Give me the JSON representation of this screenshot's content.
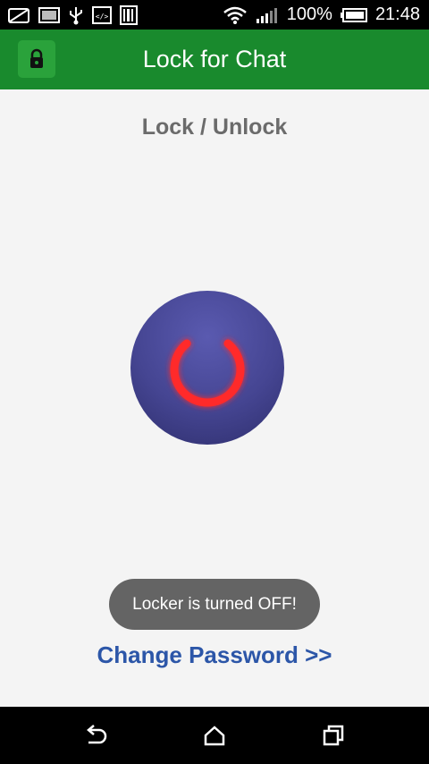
{
  "status_bar": {
    "battery_text": "100%",
    "time": "21:48",
    "icons": [
      "no-sim-icon",
      "screenshot-icon",
      "usb-icon",
      "developer-icon",
      "barcode-icon",
      "wifi-icon",
      "signal-icon",
      "battery-icon"
    ]
  },
  "app_bar": {
    "title": "Lock for Chat",
    "icon": "lock-icon"
  },
  "main": {
    "section_title": "Lock / Unlock",
    "power_button_icon": "power-icon",
    "toast_text": "Locker is turned OFF!",
    "change_password_label": "Change Password >>"
  },
  "nav_bar": {
    "icons": [
      "back-icon",
      "home-icon",
      "recents-icon"
    ]
  },
  "colors": {
    "app_bar": "#198a2d",
    "power_button": "#454592",
    "power_glow": "#ff3030",
    "link": "#2c56a8",
    "toast": "#646464"
  }
}
